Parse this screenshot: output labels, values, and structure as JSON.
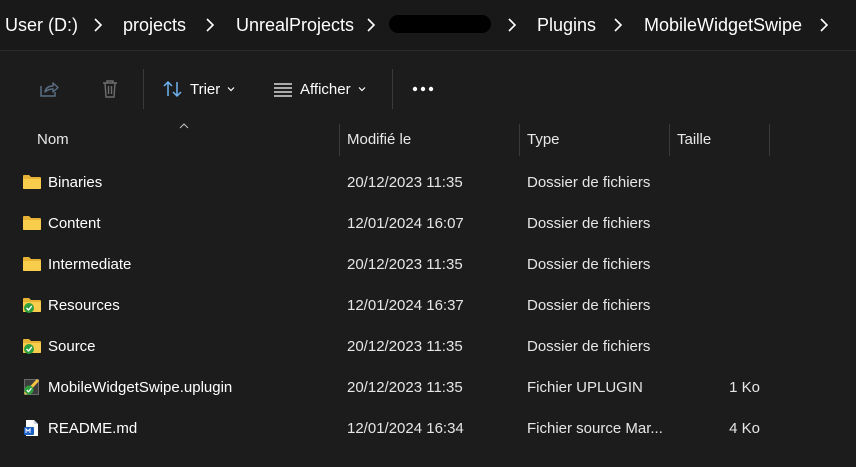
{
  "breadcrumb": {
    "items": [
      "User (D:)",
      "projects",
      "UnrealProjects",
      "Plugins",
      "MobileWidgetSwipe"
    ]
  },
  "toolbar": {
    "sort_label": "Trier",
    "view_label": "Afficher"
  },
  "columns": {
    "name": "Nom",
    "modified": "Modifié le",
    "type": "Type",
    "size": "Taille"
  },
  "files": [
    {
      "name": "Binaries",
      "modified": "20/12/2023 11:35",
      "type": "Dossier de fichiers",
      "size": "",
      "icon": "folder-icon"
    },
    {
      "name": "Content",
      "modified": "12/01/2024 16:07",
      "type": "Dossier de fichiers",
      "size": "",
      "icon": "folder-icon"
    },
    {
      "name": "Intermediate",
      "modified": "20/12/2023 11:35",
      "type": "Dossier de fichiers",
      "size": "",
      "icon": "folder-icon"
    },
    {
      "name": "Resources",
      "modified": "12/01/2024 16:37",
      "type": "Dossier de fichiers",
      "size": "",
      "icon": "folder-sync-icon"
    },
    {
      "name": "Source",
      "modified": "20/12/2023 11:35",
      "type": "Dossier de fichiers",
      "size": "",
      "icon": "folder-sync-icon"
    },
    {
      "name": "MobileWidgetSwipe.uplugin",
      "modified": "20/12/2023 11:35",
      "type": "Fichier UPLUGIN",
      "size": "1 Ko",
      "icon": "uplugin-file-icon"
    },
    {
      "name": "README.md",
      "modified": "12/01/2024 16:34",
      "type": "Fichier source Mar...",
      "size": "4 Ko",
      "icon": "markdown-file-icon"
    }
  ],
  "colors": {
    "background": "#1c1c1c",
    "folder": "#f4c542",
    "sync_badge": "#2e9e3e"
  }
}
